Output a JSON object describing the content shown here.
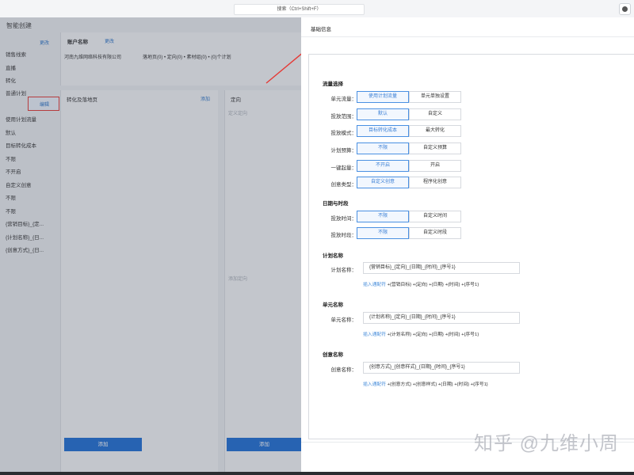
{
  "topbar": {
    "search_text": "搜索（Ctrl+Shift+F）"
  },
  "left": {
    "app_title": "智能创建",
    "sidebar_link": "更改",
    "sidebar_items": [
      "销售线索",
      "直播",
      "转化",
      "普通计划",
      "使用计划流量",
      "默认",
      "目标转化成本",
      "不限",
      "不开启",
      "自定义创意",
      "不限",
      "不限",
      "{营销目标}_{定...",
      "{计划名称}_{日...",
      "{创意方式}_{日..."
    ],
    "edit_label": "编辑",
    "account_header": "账户名称",
    "account_change": "更改",
    "account_name": "河南九维网络科技有限公司",
    "account_stats": "落地页(0) • 定向(0) • 素材组(0) • (0)个计划",
    "convert_col_title": "转化及落地页",
    "convert_col_link": "添加",
    "target_col_title": "定向",
    "target_placeholder": "定义定向",
    "target_placeholder2": "添加定向",
    "add_label": "添加"
  },
  "drawer": {
    "title": "基础信息",
    "sections": {
      "flow": "流量选择",
      "date": "日期与时段",
      "plan_name": "计划名称",
      "unit_name": "单元名称",
      "creative_name": "创意名称"
    },
    "rows": [
      {
        "label": "单元流量：",
        "options": [
          "使用计划流量",
          "单元单独设置"
        ],
        "selected": 0
      },
      {
        "label": "投放范围：",
        "options": [
          "默认",
          "自定义"
        ],
        "selected": 0
      },
      {
        "label": "投放模式：",
        "options": [
          "目标转化成本",
          "最大转化"
        ],
        "selected": 0
      },
      {
        "label": "计划预算：",
        "options": [
          "不限",
          "自定义预算"
        ],
        "selected": 0
      },
      {
        "label": "一键起量：",
        "options": [
          "不开启",
          "开启"
        ],
        "selected": 0
      },
      {
        "label": "创意类型：",
        "options": [
          "自定义创意",
          "程序化创意"
        ],
        "selected": 0
      }
    ],
    "date_rows": [
      {
        "label": "投放时间：",
        "options": [
          "不限",
          "自定义时间"
        ],
        "selected": 0
      },
      {
        "label": "投放时段：",
        "options": [
          "不限",
          "自定义时段"
        ],
        "selected": 0
      }
    ],
    "plan_name": {
      "label": "计划名称：",
      "value": "{营销目标}_{定向}_{日期}_{时间}_{序号1}",
      "hint": "插入通配符",
      "tokens": "+{营销目标}  +{定向}  +{日期}  +{时间}  +{序号1}"
    },
    "unit_name": {
      "label": "单元名称：",
      "value": "{计划名称}_{定向}_{日期}_{时间}_{序号1}",
      "hint": "插入通配符",
      "tokens": "+{计划名称}  +{定向}  +{日期}  +{时间}  +{序号1}"
    },
    "creative_name": {
      "label": "创意名称：",
      "value": "{创意方式}_{创意样式}_{日期}_{时间}_{序号1}",
      "hint": "插入通配符",
      "tokens": "+{创意方式}  +{创意样式}  +{日期}  +{时间}  +{序号1}"
    }
  },
  "watermark": "知乎 @九维小周",
  "colors": {
    "accent": "#4a90e2",
    "highlight": "#e53935",
    "add_button": "#1f6fd6"
  }
}
